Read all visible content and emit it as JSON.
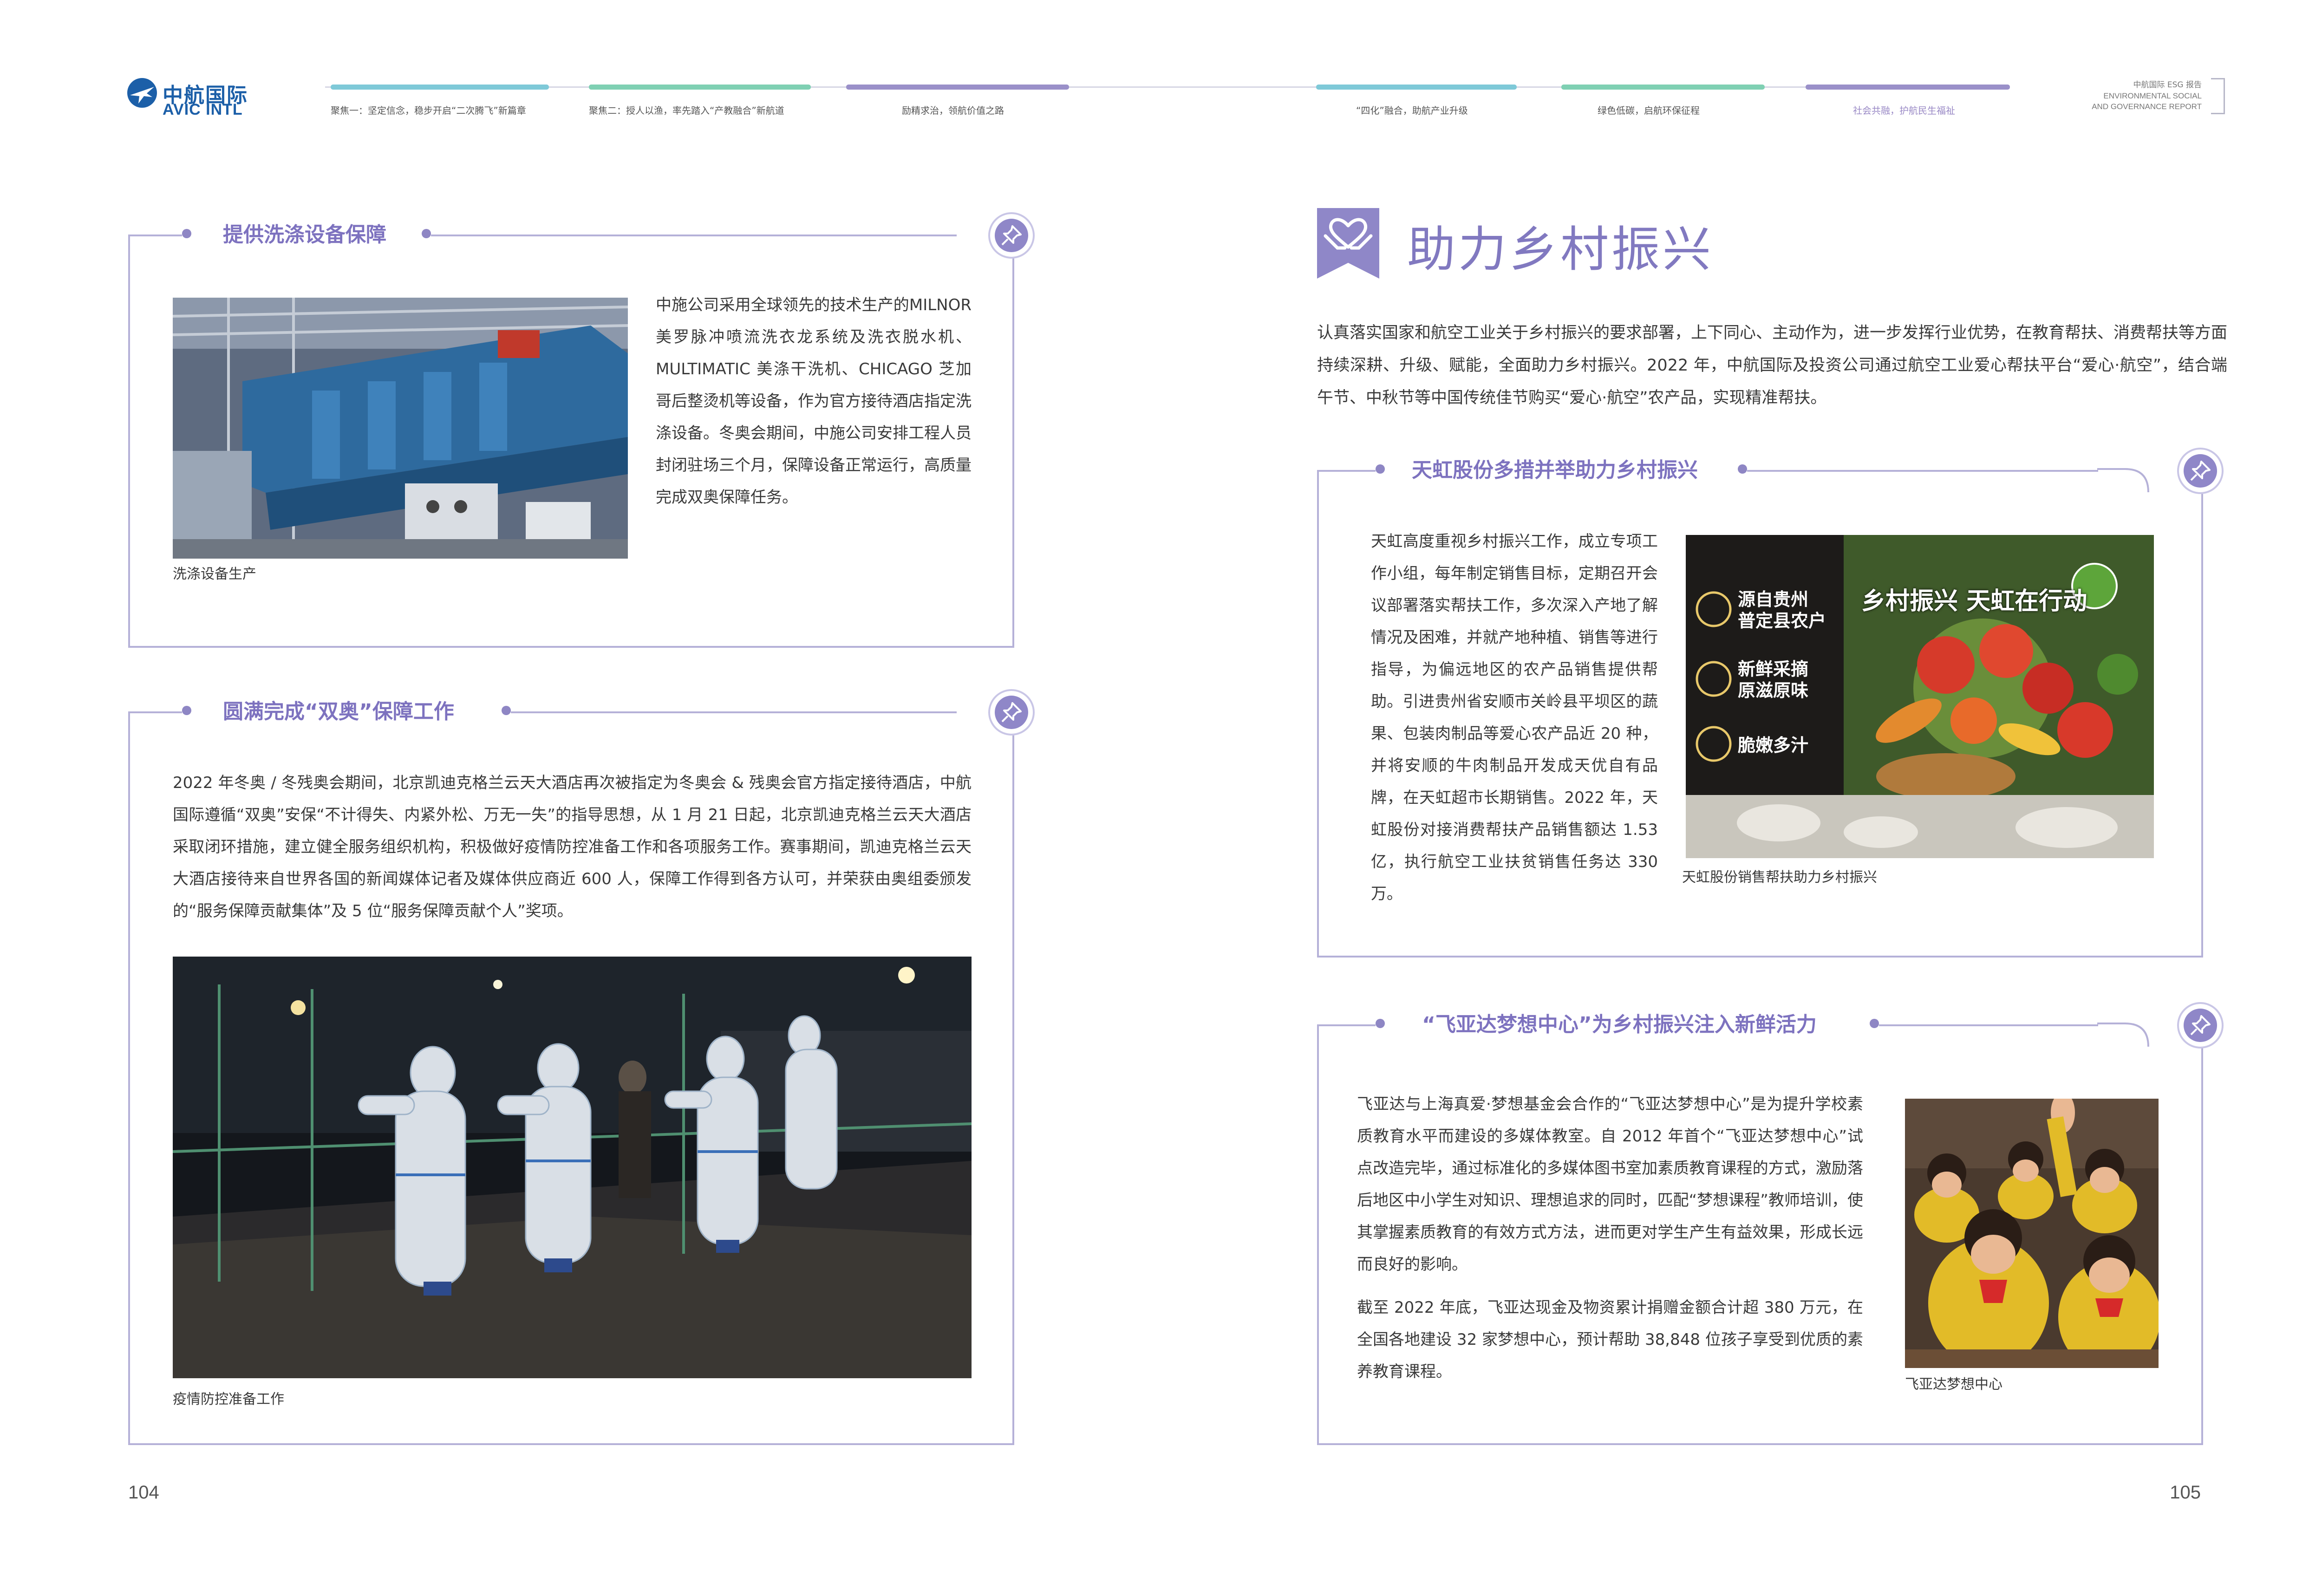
{
  "header": {
    "logo": {
      "cn": "中航国际",
      "en": "AVIC INTL"
    },
    "nav": [
      {
        "label": "聚焦一：坚定信念，稳步开启“二次腾飞”新篇章",
        "color": "#7ec9d8",
        "active": false
      },
      {
        "label": "聚焦二：授人以渔，率先踏入“产教融合”新航道",
        "color": "#7fd0b3",
        "active": false
      },
      {
        "label": "励精求治，领航价值之路",
        "color": "#9a90c9",
        "active": false
      },
      {
        "label": "“四化”融合，助航产业升级",
        "color": "#7ec9d8",
        "active": false
      },
      {
        "label": "绿色低碳，启航环保征程",
        "color": "#7fd0b3",
        "active": false
      },
      {
        "label": "社会共融，护航民生福祉",
        "color": "#9a90c9",
        "active": true
      }
    ],
    "report": {
      "line1": "中航国际 ESG 报告",
      "line2": "ENVIRONMENTAL SOCIAL",
      "line3": "AND GOVERNANCE REPORT"
    }
  },
  "left": {
    "laundry": {
      "title": "提供洗涤设备保障",
      "text": "中施公司采用全球领先的技术生产的MILNOR 美罗脉冲喷流洗衣龙系统及洗衣脱水机、MULTIMATIC 美涤干洗机、CHICAGO 芝加哥后整烫机等设备，作为官方接待酒店指定洗涤设备。冬奥会期间，中施公司安排工程人员封闭驻场三个月，保障设备正常运行，高质量完成双奥保障任务。",
      "caption": "洗涤设备生产"
    },
    "olympics": {
      "title": "圆满完成“双奥”保障工作",
      "text": "2022 年冬奥 / 冬残奥会期间，北京凯迪克格兰云天大酒店再次被指定为冬奥会 & 残奥会官方指定接待酒店，中航国际遵循“双奥”安保“不计得失、内紧外松、万无一失”的指导思想，从 1 月 21 日起，北京凯迪克格兰云天大酒店采取闭环措施，建立健全服务组织机构，积极做好疫情防控准备工作和各项服务工作。赛事期间，凯迪克格兰云天大酒店接待来自世界各国的新闻媒体记者及媒体供应商近 600 人，保障工作得到各方认可，并荣获由奥组委颁发的“服务保障贡献集体”及 5 位“服务保障贡献个人”奖项。",
      "caption": "疫情防控准备工作"
    },
    "page_number": "104"
  },
  "right": {
    "section_title": "助力乡村振兴",
    "intro": "认真落实国家和航空工业关于乡村振兴的要求部署，上下同心、主动作为，进一步发挥行业优势，在教育帮扶、消费帮扶等方面持续深耕、升级、赋能，全面助力乡村振兴。2022 年，中航国际及投资公司通过航空工业爱心帮扶平台“爱心·航空”，结合端午节、中秋节等中国传统佳节购买“爱心·航空”农产品，实现精准帮扶。",
    "tianhong": {
      "title": "天虹股份多措并举助力乡村振兴",
      "text": "天虹高度重视乡村振兴工作，成立专项工作小组，每年制定销售目标，定期召开会议部署落实帮扶工作，多次深入产地了解情况及困难，并就产地种植、销售等进行指导，为偏远地区的农产品销售提供帮助。引进贵州省安顺市关岭县平坝区的蔬果、包装肉制品等爱心农产品近 20 种，并将安顺的牛肉制品开发成天优自有品牌，在天虹超市长期销售。2022 年，天虹股份对接消费帮扶产品销售额达 1.53 亿，执行航空工业扶贫销售任务达 330 万。",
      "caption": "天虹股份销售帮扶助力乡村振兴",
      "poster": {
        "banner": "乡村振兴  天虹在行动",
        "items": [
          "源自贵州\n普定县农户",
          "新鲜采摘\n原滋原味",
          "脆嫩多汁"
        ]
      }
    },
    "feiyada": {
      "title": "“飞亚达梦想中心”为乡村振兴注入新鲜活力",
      "text1": "飞亚达与上海真爱·梦想基金会合作的“飞亚达梦想中心”是为提升学校素质教育水平而建设的多媒体教室。自 2012 年首个“飞亚达梦想中心”试点改造完毕，通过标准化的多媒体图书室加素质教育课程的方式，激励落后地区中小学生对知识、理想追求的同时，匹配“梦想课程”教师培训，使其掌握素质教育的有效方式方法，进而更对学生产生有益效果，形成长远而良好的影响。",
      "text2": "截至 2022 年底，飞亚达现金及物资累计捐赠金额合计超 380 万元，在全国各地建设 32 家梦想中心，预计帮助 38,848 位孩子享受到优质的素养教育课程。",
      "caption": "飞亚达梦想中心"
    },
    "page_number": "105"
  }
}
